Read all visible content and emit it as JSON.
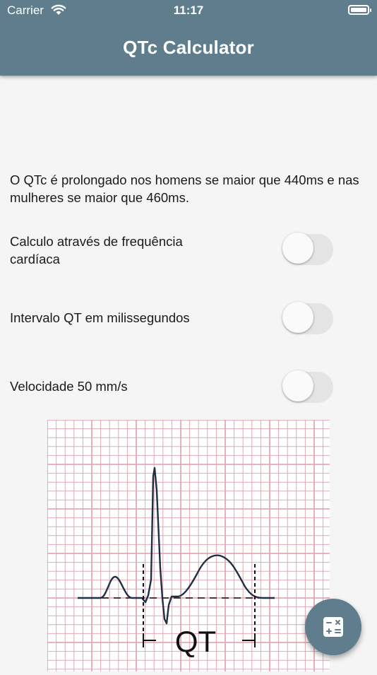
{
  "status_bar": {
    "carrier": "Carrier",
    "time": "11:17"
  },
  "app_bar": {
    "title": "QTc Calculator"
  },
  "info_text": "O QTc é prolongado nos homens se maior que 440ms e nas mulheres se maior que 460ms.",
  "toggles": [
    {
      "label": "Calculo através de frequência cardíaca",
      "on": false
    },
    {
      "label": "Intervalo QT em milissegundos",
      "on": false
    },
    {
      "label": "Velocidade 50 mm/s",
      "on": false
    }
  ],
  "ecg_image": {
    "interval_label": "QT"
  },
  "fab": {
    "icon": "calculator-icon"
  },
  "colors": {
    "primary": "#5f7d8c",
    "background": "#f5f5f5",
    "grid": "#e2a9b4"
  }
}
